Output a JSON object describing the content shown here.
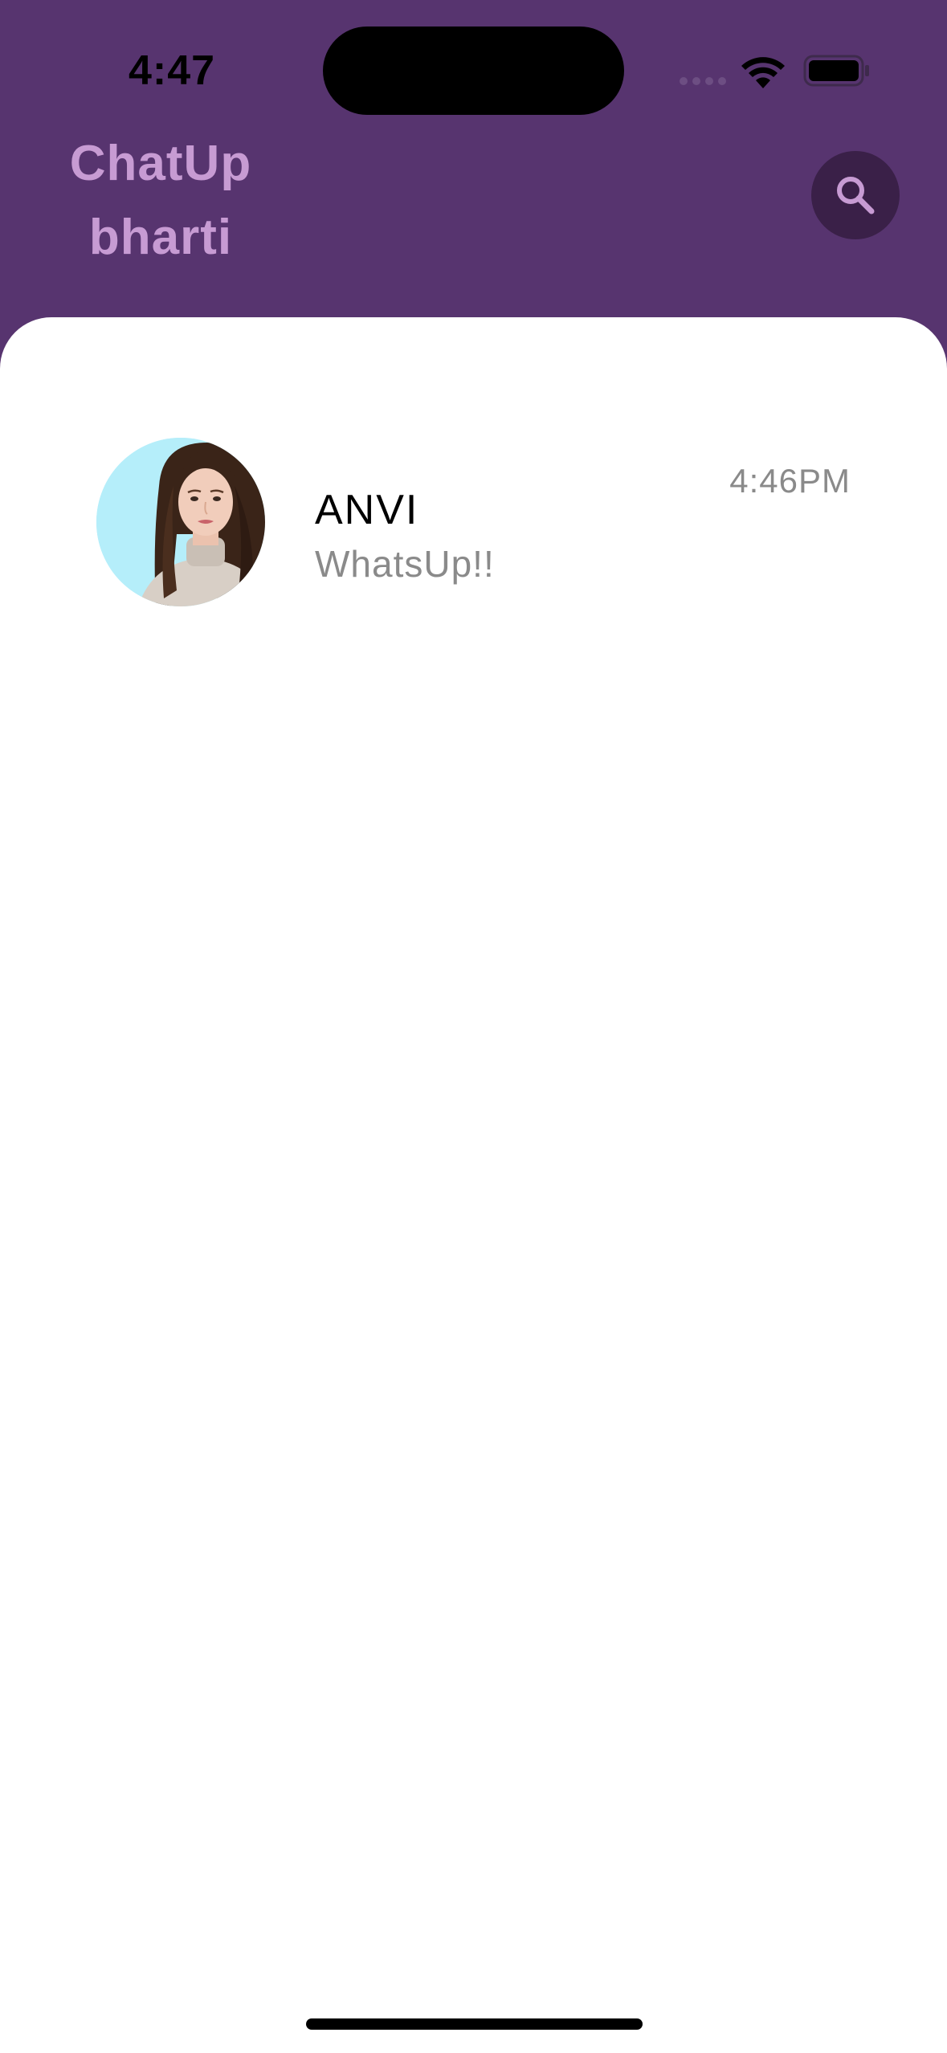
{
  "status_bar": {
    "time": "4:47",
    "icons": [
      "cellular-signal-icon",
      "wifi-icon",
      "battery-icon"
    ]
  },
  "header": {
    "title_line1": "ChatUp",
    "title_line2": "bharti",
    "search_icon": "search-icon"
  },
  "chats": [
    {
      "name": "ANVI",
      "preview": "WhatsUp!!",
      "time": "4:46PM",
      "avatar": "avatar"
    }
  ],
  "colors": {
    "header_background": "#57346F",
    "title": "#C79BD3",
    "search_button": "#3A2048",
    "content_background": "#FFFFFF",
    "secondary_text": "#8A8A8A"
  }
}
